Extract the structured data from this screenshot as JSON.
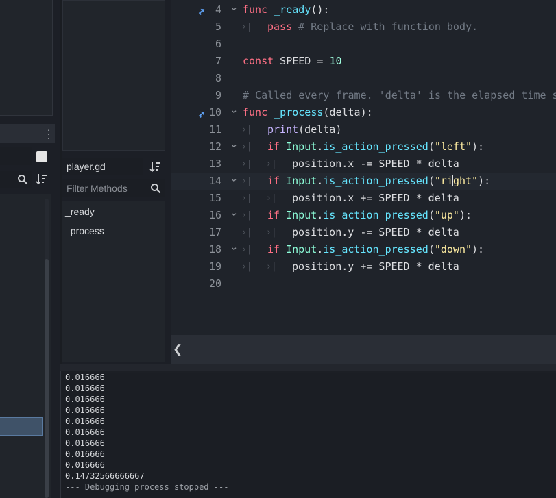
{
  "script_panel": {
    "script_name": "player.gd",
    "filter_placeholder": "Filter Methods",
    "methods": [
      "_ready",
      "_process"
    ]
  },
  "editor": {
    "lines": [
      {
        "num": "4",
        "override": true,
        "fold": true,
        "indent": 0,
        "tokens": [
          {
            "t": "func",
            "c": "kw"
          },
          {
            "t": " "
          },
          {
            "t": "_ready",
            "c": "fn"
          },
          {
            "t": "():"
          }
        ]
      },
      {
        "num": "5",
        "indent": 1,
        "tokens": [
          {
            "t": "pass",
            "c": "kw"
          },
          {
            "t": " "
          },
          {
            "t": "# Replace with function body.",
            "c": "cmt"
          }
        ]
      },
      {
        "num": "6",
        "indent": 0,
        "tokens": []
      },
      {
        "num": "7",
        "indent": 0,
        "tokens": [
          {
            "t": "const",
            "c": "kw"
          },
          {
            "t": " SPEED = "
          },
          {
            "t": "10",
            "c": "num"
          }
        ]
      },
      {
        "num": "8",
        "indent": 0,
        "tokens": []
      },
      {
        "num": "9",
        "indent": 0,
        "tokens": [
          {
            "t": "# Called every frame. 'delta' is the elapsed time s",
            "c": "cmt"
          }
        ]
      },
      {
        "num": "10",
        "override": true,
        "fold": true,
        "indent": 0,
        "tokens": [
          {
            "t": "func",
            "c": "kw"
          },
          {
            "t": " "
          },
          {
            "t": "_process",
            "c": "fn"
          },
          {
            "t": "(delta):"
          }
        ]
      },
      {
        "num": "11",
        "indent": 1,
        "tokens": [
          {
            "t": "print",
            "c": "call"
          },
          {
            "t": "(delta)"
          }
        ]
      },
      {
        "num": "12",
        "fold": true,
        "indent": 1,
        "tokens": [
          {
            "t": "if",
            "c": "kw"
          },
          {
            "t": " "
          },
          {
            "t": "Input",
            "c": "cls"
          },
          {
            "t": "."
          },
          {
            "t": "is_action_pressed",
            "c": "fn"
          },
          {
            "t": "("
          },
          {
            "t": "\"left\"",
            "c": "str"
          },
          {
            "t": "):"
          }
        ]
      },
      {
        "num": "13",
        "indent": 2,
        "tokens": [
          {
            "t": "position.x -= SPEED * delta"
          }
        ]
      },
      {
        "num": "14",
        "fold": true,
        "indent": 1,
        "current": true,
        "tokens": [
          {
            "t": "if",
            "c": "kw"
          },
          {
            "t": " "
          },
          {
            "t": "Input",
            "c": "cls"
          },
          {
            "t": "."
          },
          {
            "t": "is_action_pressed",
            "c": "fn"
          },
          {
            "t": "("
          },
          {
            "t": "\"ri",
            "c": "str"
          },
          {
            "t": "|",
            "c": "cursor"
          },
          {
            "t": "ght\"",
            "c": "str"
          },
          {
            "t": "):"
          }
        ]
      },
      {
        "num": "15",
        "indent": 2,
        "tokens": [
          {
            "t": "position.x += SPEED * delta"
          }
        ]
      },
      {
        "num": "16",
        "fold": true,
        "indent": 1,
        "tokens": [
          {
            "t": "if",
            "c": "kw"
          },
          {
            "t": " "
          },
          {
            "t": "Input",
            "c": "cls"
          },
          {
            "t": "."
          },
          {
            "t": "is_action_pressed",
            "c": "fn"
          },
          {
            "t": "("
          },
          {
            "t": "\"up\"",
            "c": "str"
          },
          {
            "t": "):"
          }
        ]
      },
      {
        "num": "17",
        "indent": 2,
        "tokens": [
          {
            "t": "position.y -= SPEED * delta"
          }
        ]
      },
      {
        "num": "18",
        "fold": true,
        "indent": 1,
        "tokens": [
          {
            "t": "if",
            "c": "kw"
          },
          {
            "t": " "
          },
          {
            "t": "Input",
            "c": "cls"
          },
          {
            "t": "."
          },
          {
            "t": "is_action_pressed",
            "c": "fn"
          },
          {
            "t": "("
          },
          {
            "t": "\"down\"",
            "c": "str"
          },
          {
            "t": "):"
          }
        ]
      },
      {
        "num": "19",
        "indent": 2,
        "tokens": [
          {
            "t": "position.y += SPEED * delta"
          }
        ]
      },
      {
        "num": "20",
        "indent": 0,
        "tokens": []
      }
    ],
    "tab_marker": "›|",
    "toggle_icon": "❮"
  },
  "output": {
    "lines": [
      "0.016666",
      "0.016666",
      "0.016666",
      "0.016666",
      "0.016666",
      "0.016666",
      "0.016666",
      "0.016666",
      "0.016666",
      "0.14732566666667",
      "--- Debugging process stopped ---"
    ]
  },
  "colors": {
    "keyword": "#ff7085",
    "function": "#66e6ff",
    "class": "#8effda",
    "string": "#ffeda1",
    "comment": "#737b86",
    "selection": "#3f5268"
  },
  "icons": [
    "search-icon",
    "sort-icon",
    "override-icon",
    "fold-arrow-icon",
    "kebab-menu-icon",
    "collapse-panel-icon"
  ]
}
